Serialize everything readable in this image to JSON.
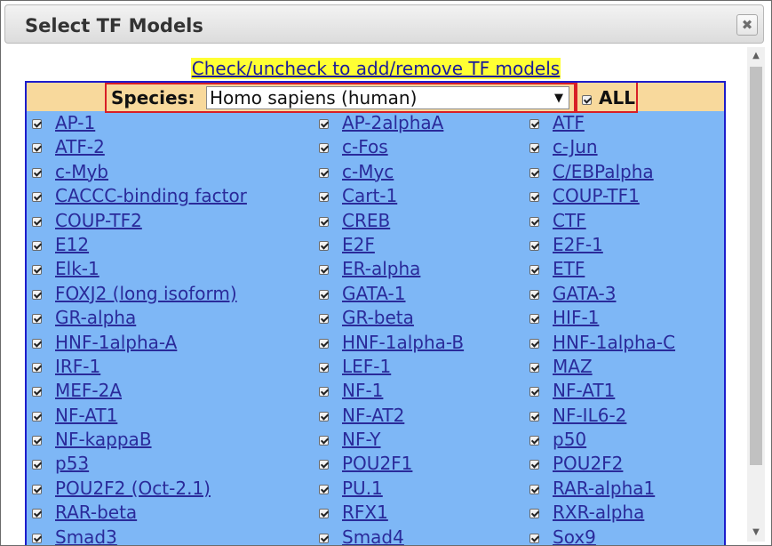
{
  "dialog": {
    "title": "Select TF Models",
    "close_glyph": "✖"
  },
  "hint": "Check/uncheck to add/remove TF models",
  "species": {
    "label": "Species:",
    "selected": "Homo sapiens (human)",
    "arrow_glyph": "▼"
  },
  "all": {
    "label": "ALL",
    "checked": true
  },
  "scrollbar": {
    "up_glyph": "▲",
    "down_glyph": "▼"
  },
  "tf_rows": [
    [
      "AP-1",
      "AP-2alphaA",
      "ATF"
    ],
    [
      "ATF-2",
      "c-Fos",
      "c-Jun"
    ],
    [
      "c-Myb",
      "c-Myc",
      "C/EBPalpha"
    ],
    [
      "CACCC-binding factor",
      "Cart-1",
      "COUP-TF1"
    ],
    [
      "COUP-TF2",
      "CREB",
      "CTF"
    ],
    [
      "E12",
      "E2F",
      "E2F-1"
    ],
    [
      "Elk-1",
      "ER-alpha",
      "ETF"
    ],
    [
      "FOXJ2 (long isoform)",
      "GATA-1",
      "GATA-3"
    ],
    [
      "GR-alpha",
      "GR-beta",
      "HIF-1"
    ],
    [
      "HNF-1alpha-A",
      "HNF-1alpha-B",
      "HNF-1alpha-C"
    ],
    [
      "IRF-1",
      "LEF-1",
      "MAZ"
    ],
    [
      "MEF-2A",
      "NF-1",
      "NF-AT1"
    ],
    [
      "NF-AT1",
      "NF-AT2",
      "NF-IL6-2"
    ],
    [
      "NF-kappaB",
      "NF-Y",
      "p50"
    ],
    [
      "p53",
      "POU2F1",
      "POU2F2"
    ],
    [
      "POU2F2 (Oct-2.1)",
      "PU.1",
      "RAR-alpha1"
    ],
    [
      "RAR-beta",
      "RFX1",
      "RXR-alpha"
    ],
    [
      "Smad3",
      "Smad4",
      "Sox9"
    ]
  ]
}
